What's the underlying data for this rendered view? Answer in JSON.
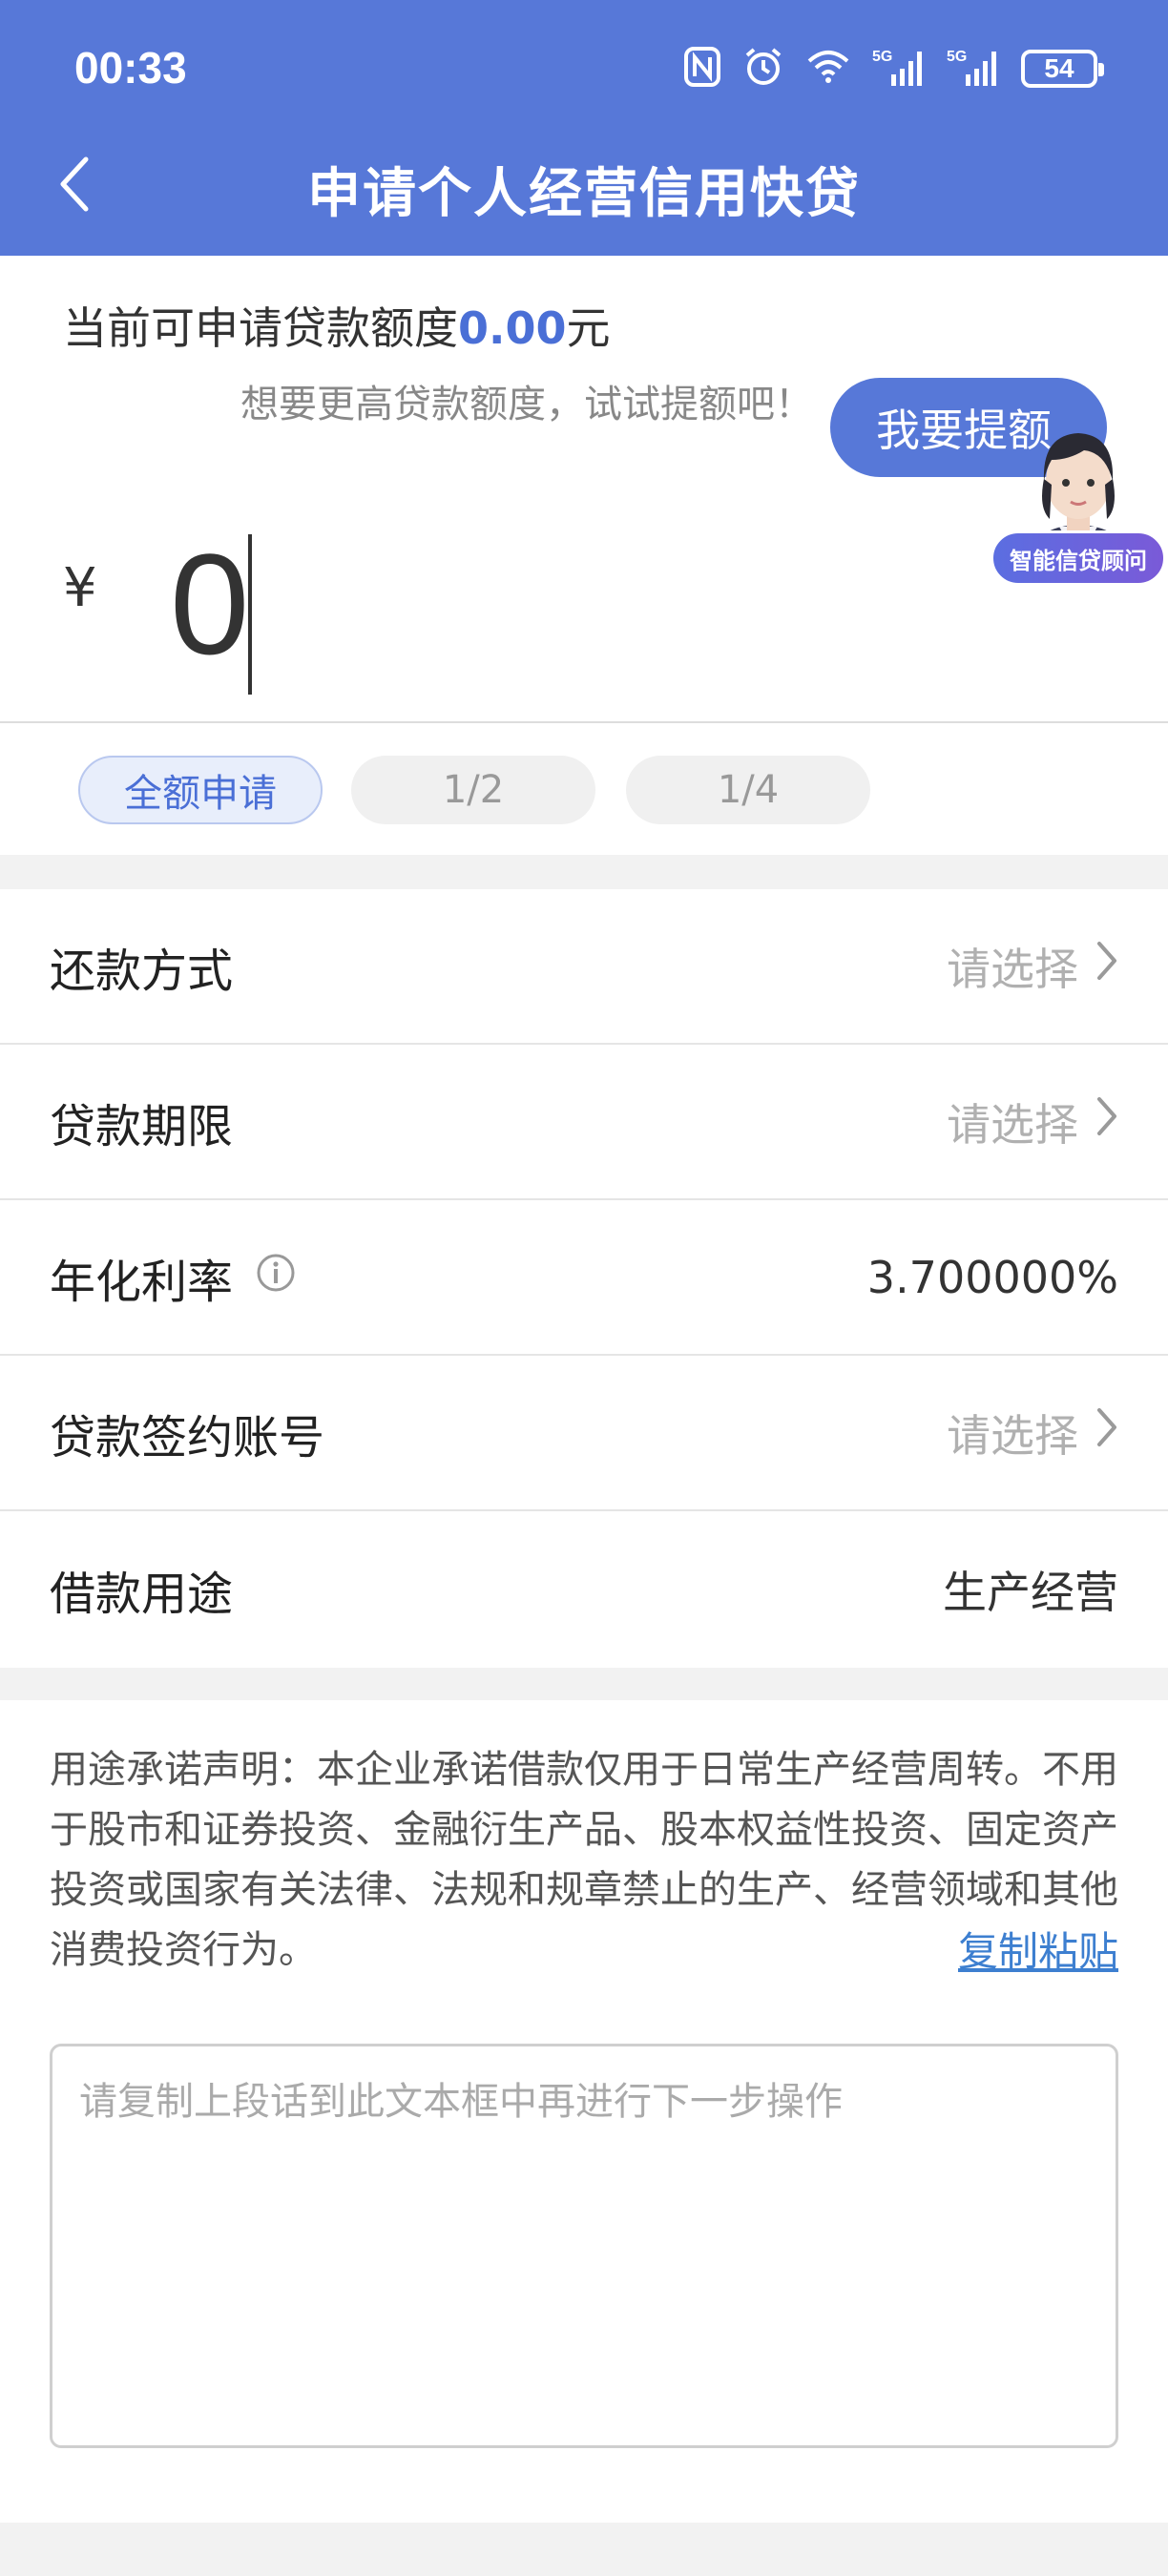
{
  "status_bar": {
    "time": "00:33",
    "battery": "54",
    "icons": [
      "nfc-icon",
      "alarm-icon",
      "wifi-icon",
      "signal-5g-icon",
      "signal-5g-icon"
    ]
  },
  "header": {
    "title": "申请个人经营信用快贷",
    "back_icon": "chevron-left-icon",
    "background": "#5778d8"
  },
  "amount": {
    "available_prefix": "当前可申请贷款额度",
    "available_value": "0.00",
    "available_suffix": "元",
    "raise_hint": "想要更高贷款额度，试试提额吧！",
    "raise_button": "我要提额",
    "advisor_badge": "智能信贷顾问",
    "currency_symbol": "¥",
    "input_value": "0",
    "accent": "#4a6fd6"
  },
  "ratio_chips": [
    {
      "label": "全额申请",
      "active": true
    },
    {
      "label": "1/2",
      "active": false
    },
    {
      "label": "1/4",
      "active": false
    }
  ],
  "form": {
    "rows": [
      {
        "label": "还款方式",
        "value": "请选择"
      },
      {
        "label": "贷款期限",
        "value": "请选择"
      },
      {
        "label": "年化利率",
        "value": "3.700000%"
      },
      {
        "label": "贷款签约账号",
        "value": "请选择"
      },
      {
        "label": "借款用途",
        "value": "生产经营"
      }
    ]
  },
  "declaration": {
    "text": "用途承诺声明：本企业承诺借款仅用于日常生产经营周转。不用于股市和证券投资、金融衍生产品、股本权益性投资、固定资产投资或国家有关法律、法规和规章禁止的生产、经营领域和其他消费投资行为。",
    "copy_link": "复制粘贴",
    "textarea_placeholder": "请复制上段话到此文本框中再进行下一步操作"
  }
}
